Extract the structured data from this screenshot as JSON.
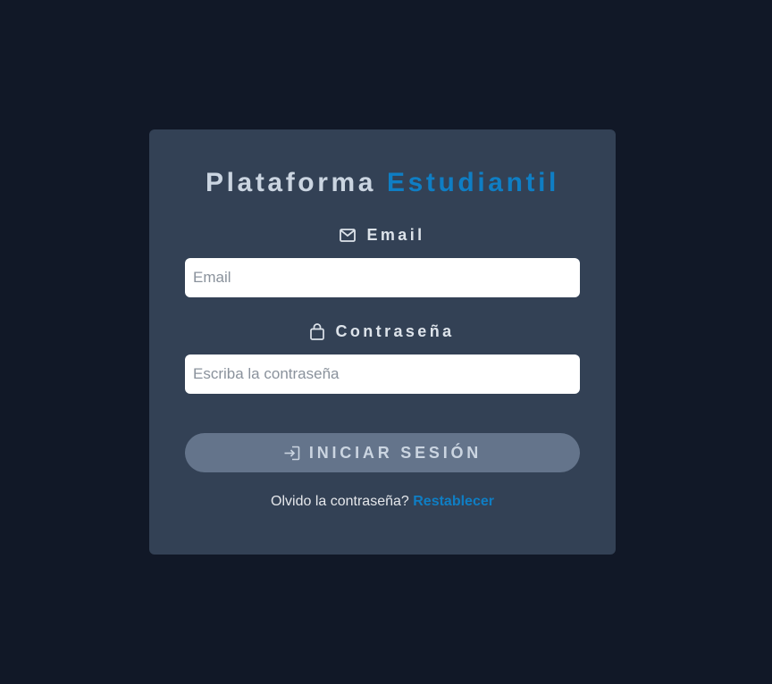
{
  "app": {
    "title_main": "Plataforma",
    "title_accent": "Estudiantil"
  },
  "form": {
    "email": {
      "label": "Email",
      "icon": "envelope-icon",
      "placeholder": "Email",
      "value": ""
    },
    "password": {
      "label": "Contraseña",
      "icon": "lock-icon",
      "placeholder": "Escriba la contraseña",
      "value": ""
    },
    "submit": {
      "label": "INICIAR SESIÓN",
      "icon": "sign-in-icon"
    },
    "forgot": {
      "text": "Olvido la contraseña?",
      "link_label": "Restablecer"
    }
  },
  "colors": {
    "background": "#111827",
    "card": "#334155",
    "accent": "#0f7ec4",
    "button": "#64748b"
  }
}
